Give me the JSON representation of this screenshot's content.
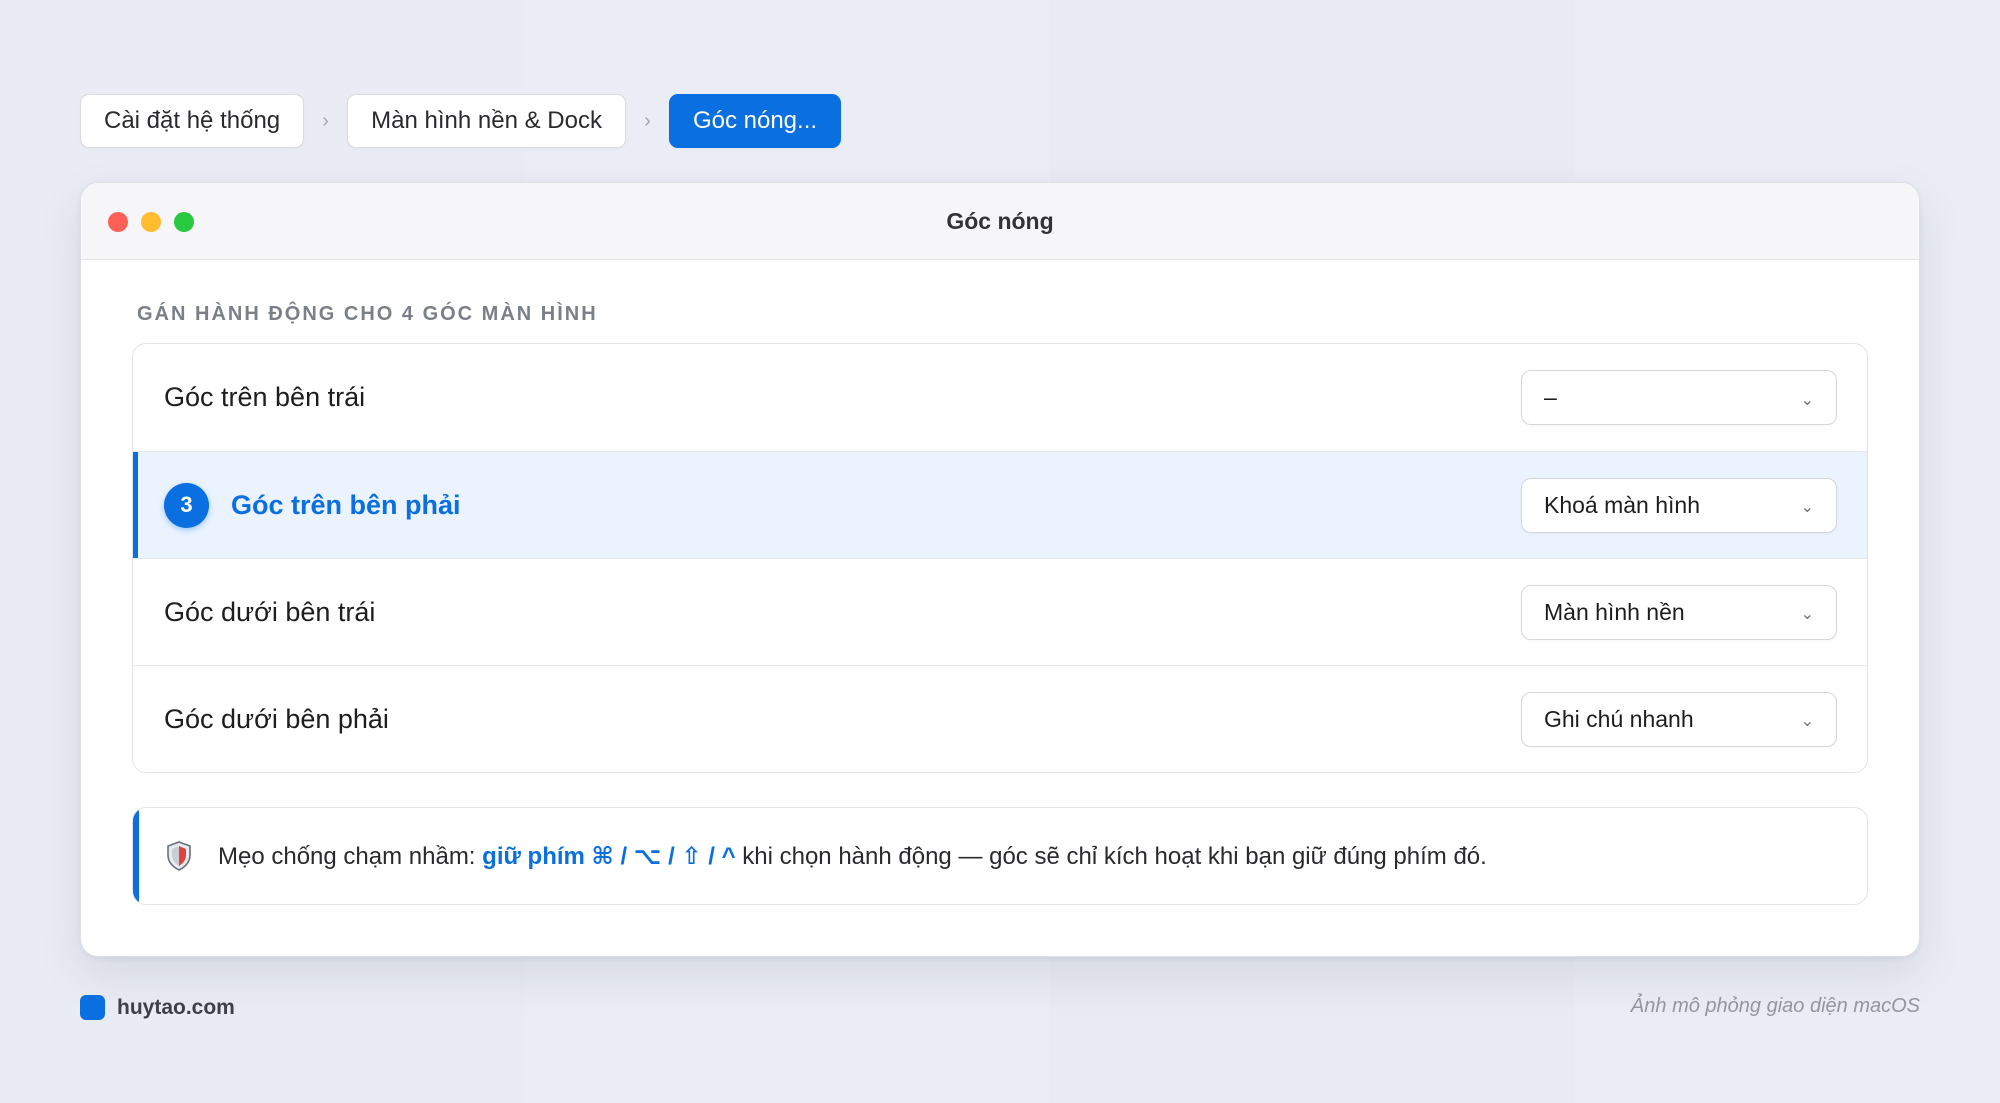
{
  "breadcrumb": {
    "items": [
      {
        "label": "Cài đặt hệ thống"
      },
      {
        "label": "Màn hình nền & Dock"
      },
      {
        "label": "Góc nóng..."
      }
    ],
    "separator": "›"
  },
  "window": {
    "title": "Góc nóng",
    "section_title": "GÁN HÀNH ĐỘNG CHO 4 GÓC MÀN HÌNH",
    "corners": [
      {
        "label": "Góc trên bên trái",
        "value": "–"
      },
      {
        "label": "Góc trên bên phải",
        "value": "Khoá màn hình",
        "badge": "3"
      },
      {
        "label": "Góc dưới bên trái",
        "value": "Màn hình nền"
      },
      {
        "label": "Góc dưới bên phải",
        "value": "Ghi chú nhanh"
      }
    ],
    "chevron": "⌄",
    "tip": {
      "prefix": "Mẹo chống chạm nhầm:",
      "emphasis": "giữ phím ⌘ / ⌥ / ⇧ / ^",
      "suffix": "khi chọn hành động — góc sẽ chỉ kích hoạt khi bạn giữ đúng phím đó.",
      "icon": "shield-icon"
    }
  },
  "footer": {
    "brand": "huytao.com",
    "note": "Ảnh mô phỏng giao diện macOS"
  },
  "colors": {
    "accent": "#0a6fe0",
    "highlight_bg": "#eaf3fe",
    "traffic_red": "#fe5f57",
    "traffic_yellow": "#febc2e",
    "traffic_green": "#28c840"
  }
}
